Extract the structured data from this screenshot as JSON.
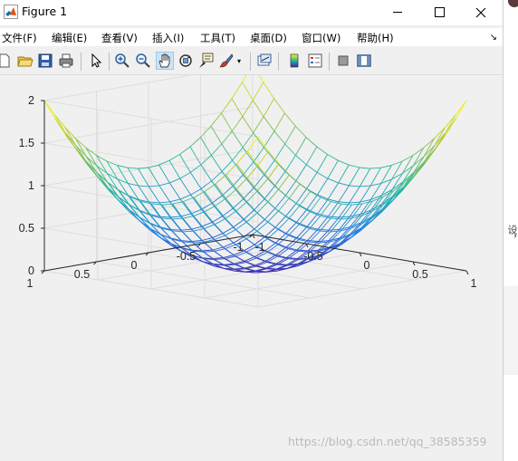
{
  "window": {
    "title": "Figure 1",
    "icon": "matlab-logo-icon",
    "controls": [
      "minimize-icon",
      "maximize-icon",
      "close-icon"
    ]
  },
  "menu": {
    "items": [
      "文件(F)",
      "编辑(E)",
      "查看(V)",
      "插入(I)",
      "工具(T)",
      "桌面(D)",
      "窗口(W)",
      "帮助(H)"
    ],
    "overflow_icon": "arrow-icon"
  },
  "toolbar": {
    "buttons": [
      "new-figure-icon",
      "open-file-icon",
      "save-icon",
      "print-icon",
      "select-arrow-icon",
      "zoom-in-icon",
      "zoom-out-icon",
      "pan-hand-icon",
      "rotate-3d-icon",
      "data-cursor-icon",
      "brush-icon",
      "link-plot-icon",
      "colorbar-icon",
      "legend-icon",
      "hide-plot-tools-icon",
      "show-plot-tools-icon"
    ],
    "active": "pan-hand-icon"
  },
  "chart_data": {
    "type": "surface-mesh",
    "function": "z = x^2 + y^2",
    "x_range": [
      -1,
      1
    ],
    "y_range": [
      -1,
      1
    ],
    "grid_points": 21,
    "zlim": [
      0,
      2
    ],
    "x_ticks": [
      "-1",
      "-0.5",
      "0",
      "0.5",
      "1"
    ],
    "y_ticks": [
      "-1",
      "-0.5",
      "0",
      "0.5",
      "1"
    ],
    "z_ticks": [
      "0",
      "0.5",
      "1",
      "1.5",
      "2"
    ],
    "colormap": "parula",
    "grid": true,
    "title": "",
    "xlabel": "",
    "ylabel": "",
    "zlabel": ""
  },
  "background": {
    "side_text": "设，",
    "watermark": "https://blog.csdn.net/qq_38585359"
  },
  "colors": {
    "window_bg": "#f0f0f0",
    "pan_active_bg": "#cce4f7",
    "axis_color": "#262626",
    "grid_color": "#dedede"
  }
}
